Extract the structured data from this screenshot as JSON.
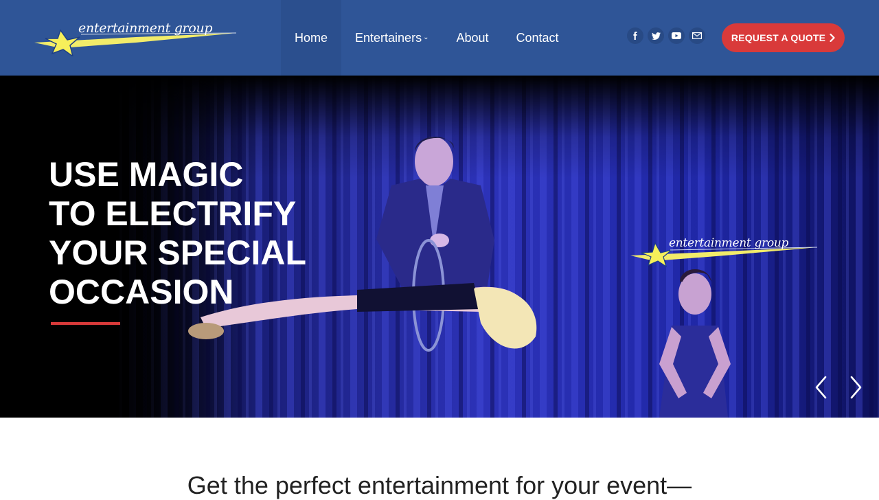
{
  "header": {
    "logo_text": "entertainment group",
    "nav": [
      {
        "label": "Home",
        "active": true
      },
      {
        "label": "Entertainers",
        "has_dropdown": true,
        "caret": "⌄"
      },
      {
        "label": "About"
      },
      {
        "label": "Contact"
      }
    ],
    "social_icons": [
      "facebook-icon",
      "twitter-icon",
      "youtube-icon",
      "mail-icon"
    ],
    "cta_label": "REQUEST A QUOTE",
    "colors": {
      "header_bg": "#2f5597",
      "accent": "#d93a3a"
    }
  },
  "hero": {
    "title_lines": [
      "USE MAGIC",
      "TO ELECTRIFY",
      "YOUR SPECIAL",
      "OCCASION"
    ],
    "logo_text": "entertainment group",
    "prev_icon": "chevron-left-icon",
    "next_icon": "chevron-right-icon"
  },
  "intro": {
    "text": "Get the perfect entertainment for your event—"
  }
}
